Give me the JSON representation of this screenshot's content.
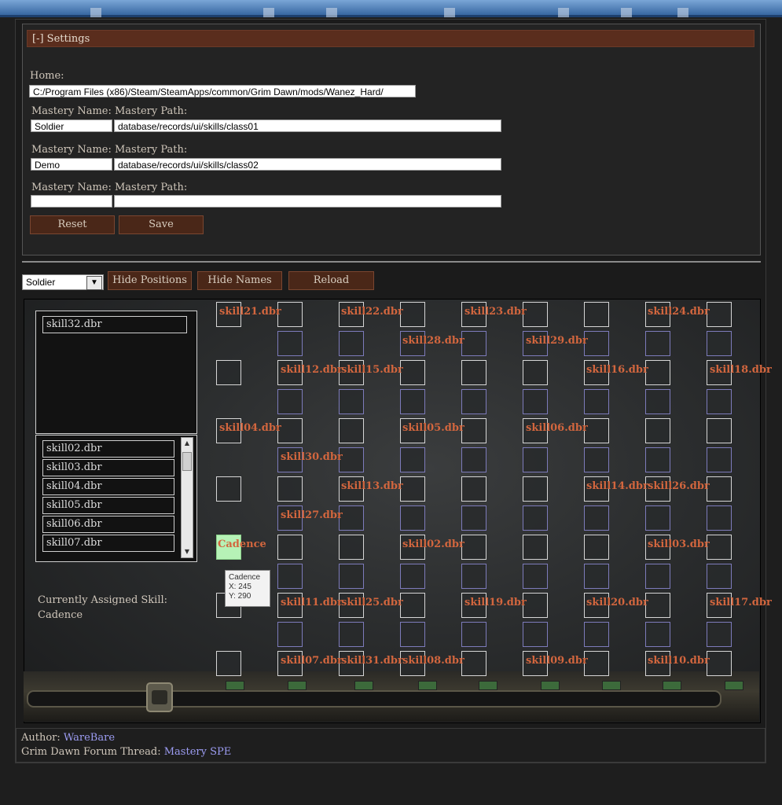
{
  "settings": {
    "header": "[-] Settings",
    "home_label": "Home:",
    "home_value": "C:/Program Files (x86)/Steam/SteamApps/common/Grim Dawn/mods/Wanez_Hard/",
    "masteries": [
      {
        "name_label": "Mastery Name:",
        "path_label": "Mastery Path:",
        "name": "Soldier",
        "path": "database/records/ui/skills/class01"
      },
      {
        "name_label": "Mastery Name:",
        "path_label": "Mastery Path:",
        "name": "Demo",
        "path": "database/records/ui/skills/class02"
      },
      {
        "name_label": "Mastery Name:",
        "path_label": "Mastery Path:",
        "name": "",
        "path": ""
      }
    ],
    "reset_label": "Reset",
    "save_label": "Save"
  },
  "toolbar": {
    "mastery_select": "Soldier",
    "hide_positions": "Hide Positions",
    "hide_names": "Hide Names",
    "reload": "Reload"
  },
  "left_panel": {
    "selected_list": [
      "skill32.dbr"
    ],
    "skill_list": [
      "skill02.dbr",
      "skill03.dbr",
      "skill04.dbr",
      "skill05.dbr",
      "skill06.dbr",
      "skill07.dbr"
    ],
    "assigned_label": "Currently Assigned Skill:",
    "assigned_value": "Cadence"
  },
  "board": {
    "labels": [
      {
        "text": "skill21.dbr"
      },
      {
        "text": "skill22.dbr"
      },
      {
        "text": "skill23.dbr"
      },
      {
        "text": "skill24.dbr"
      },
      {
        "text": "skill28.dbr"
      },
      {
        "text": "skill29.dbr"
      },
      {
        "text": "skill12.dbr"
      },
      {
        "text": "skill15.dbr"
      },
      {
        "text": "skill16.dbr"
      },
      {
        "text": "skill18.dbr"
      },
      {
        "text": "skill04.dbr"
      },
      {
        "text": "skill05.dbr"
      },
      {
        "text": "skill06.dbr"
      },
      {
        "text": "skill30.dbr"
      },
      {
        "text": "skill13.dbr"
      },
      {
        "text": "skill14.dbr"
      },
      {
        "text": "skill26.dbr"
      },
      {
        "text": "skill27.dbr"
      },
      {
        "text": "Cadence"
      },
      {
        "text": "skill02.dbr"
      },
      {
        "text": "skill03.dbr"
      },
      {
        "text": "skill11.dbr"
      },
      {
        "text": "skill25.dbr"
      },
      {
        "text": "skill19.dbr"
      },
      {
        "text": "skill20.dbr"
      },
      {
        "text": "skill17.dbr"
      },
      {
        "text": "skill07.dbr"
      },
      {
        "text": "skill31.dbr"
      },
      {
        "text": "skill08.dbr"
      },
      {
        "text": "skill09.dbr"
      },
      {
        "text": "skill10.dbr"
      }
    ],
    "tooltip": {
      "name": "Cadence",
      "x": "X: 245",
      "y": "Y: 290"
    }
  },
  "footer": {
    "author_label": "Author:",
    "author_name": "WareBare",
    "thread_label": "Grim Dawn Forum Thread:",
    "thread_link": "Mastery SPE"
  }
}
